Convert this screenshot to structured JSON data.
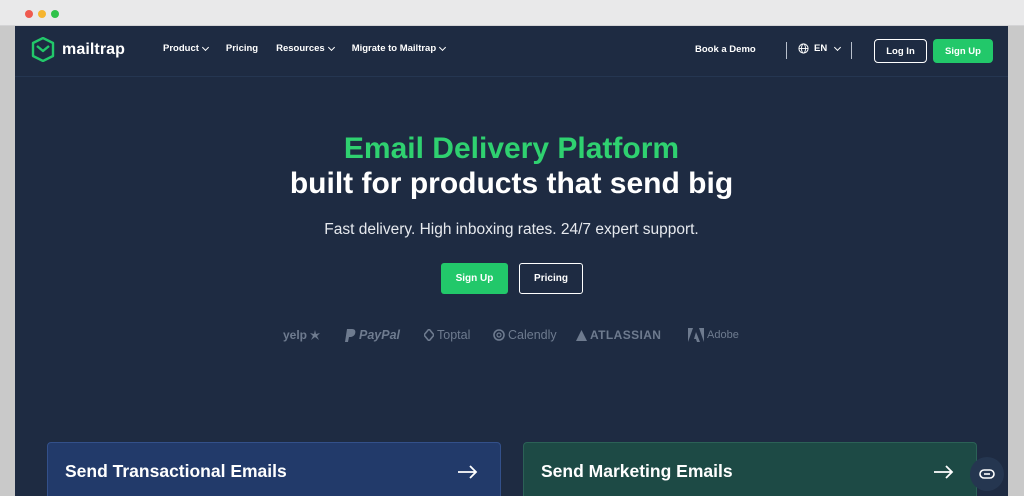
{
  "brand": {
    "name": "mailtrap",
    "accent": "#22c86a",
    "bg": "#1e2b42"
  },
  "nav": {
    "items": [
      {
        "label": "Product",
        "dropdown": true
      },
      {
        "label": "Pricing",
        "dropdown": false
      },
      {
        "label": "Resources",
        "dropdown": true
      },
      {
        "label": "Migrate to Mailtrap",
        "dropdown": true
      }
    ],
    "book_demo": "Book a Demo",
    "language": "EN",
    "login": "Log In",
    "signup": "Sign Up"
  },
  "hero": {
    "title_green": "Email Delivery Platform",
    "title_white": "built for products that send big",
    "subtitle": "Fast delivery. High inboxing rates. 24/7 expert support.",
    "cta_primary": "Sign Up",
    "cta_secondary": "Pricing"
  },
  "brands": [
    "yelp",
    "PayPal",
    "Toptal",
    "Calendly",
    "ATLASSIAN",
    "Adobe"
  ],
  "cards": [
    {
      "title": "Send Transactional Emails",
      "color": "#223a6a",
      "icon": "arrow-right-icon"
    },
    {
      "title": "Send Marketing Emails",
      "color": "#1d4a45",
      "icon": "arrow-right-icon"
    }
  ],
  "chat": {
    "icon": "chat-icon"
  }
}
